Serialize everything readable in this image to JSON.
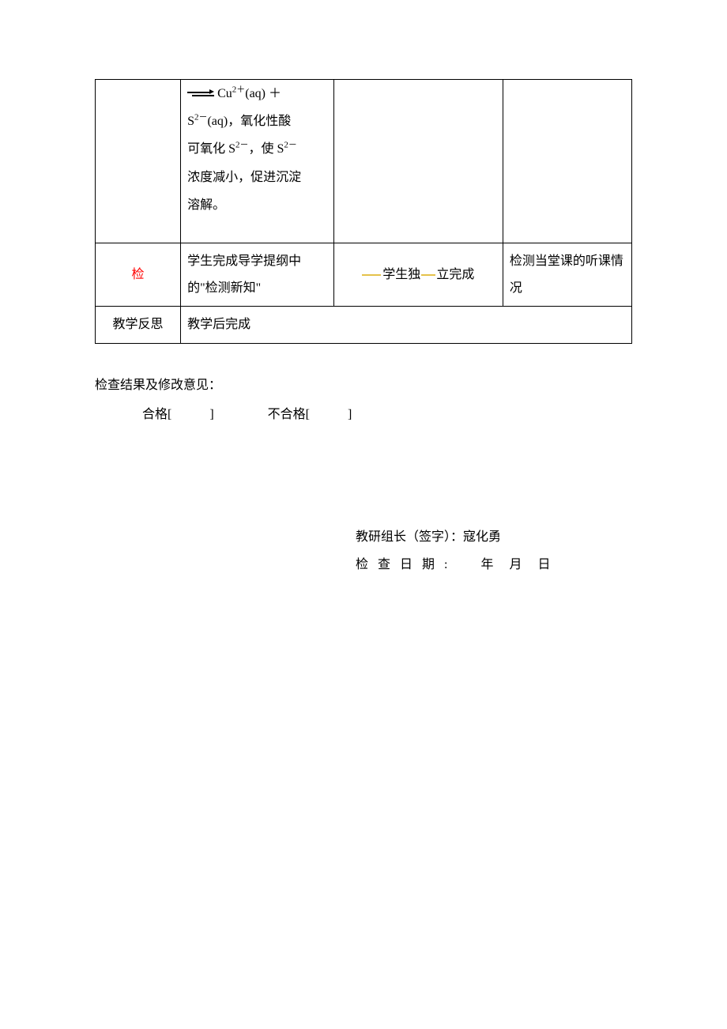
{
  "table": {
    "row1": {
      "c2_line1_pre": "",
      "c2_line1_ion": "Cu²⁺(aq) ＋",
      "c2_line2": "S²⁻(aq)，氧化性酸",
      "c2_line3": "可氧化 S²⁻，使 S²⁻",
      "c2_line4": "浓度减小，促进沉淀",
      "c2_line5": "溶解。"
    },
    "row2": {
      "c1": "检",
      "c2": "学生完成导学提纲中的\"检测新知\"",
      "c3_a": "学生独",
      "c3_b": "立完成",
      "c4": "检测当堂课的听课情况"
    },
    "row3": {
      "c1": "教学反思",
      "c2": "教学后完成"
    }
  },
  "below": {
    "title": "检查结果及修改意见：",
    "pass": "合格[　　　]",
    "fail": "不合格[　　　]",
    "leader_label": "教研组长（签字）：",
    "leader_name": "寇化勇",
    "date_label": "检查日期:",
    "year": "年",
    "month": "月",
    "day": "日"
  }
}
